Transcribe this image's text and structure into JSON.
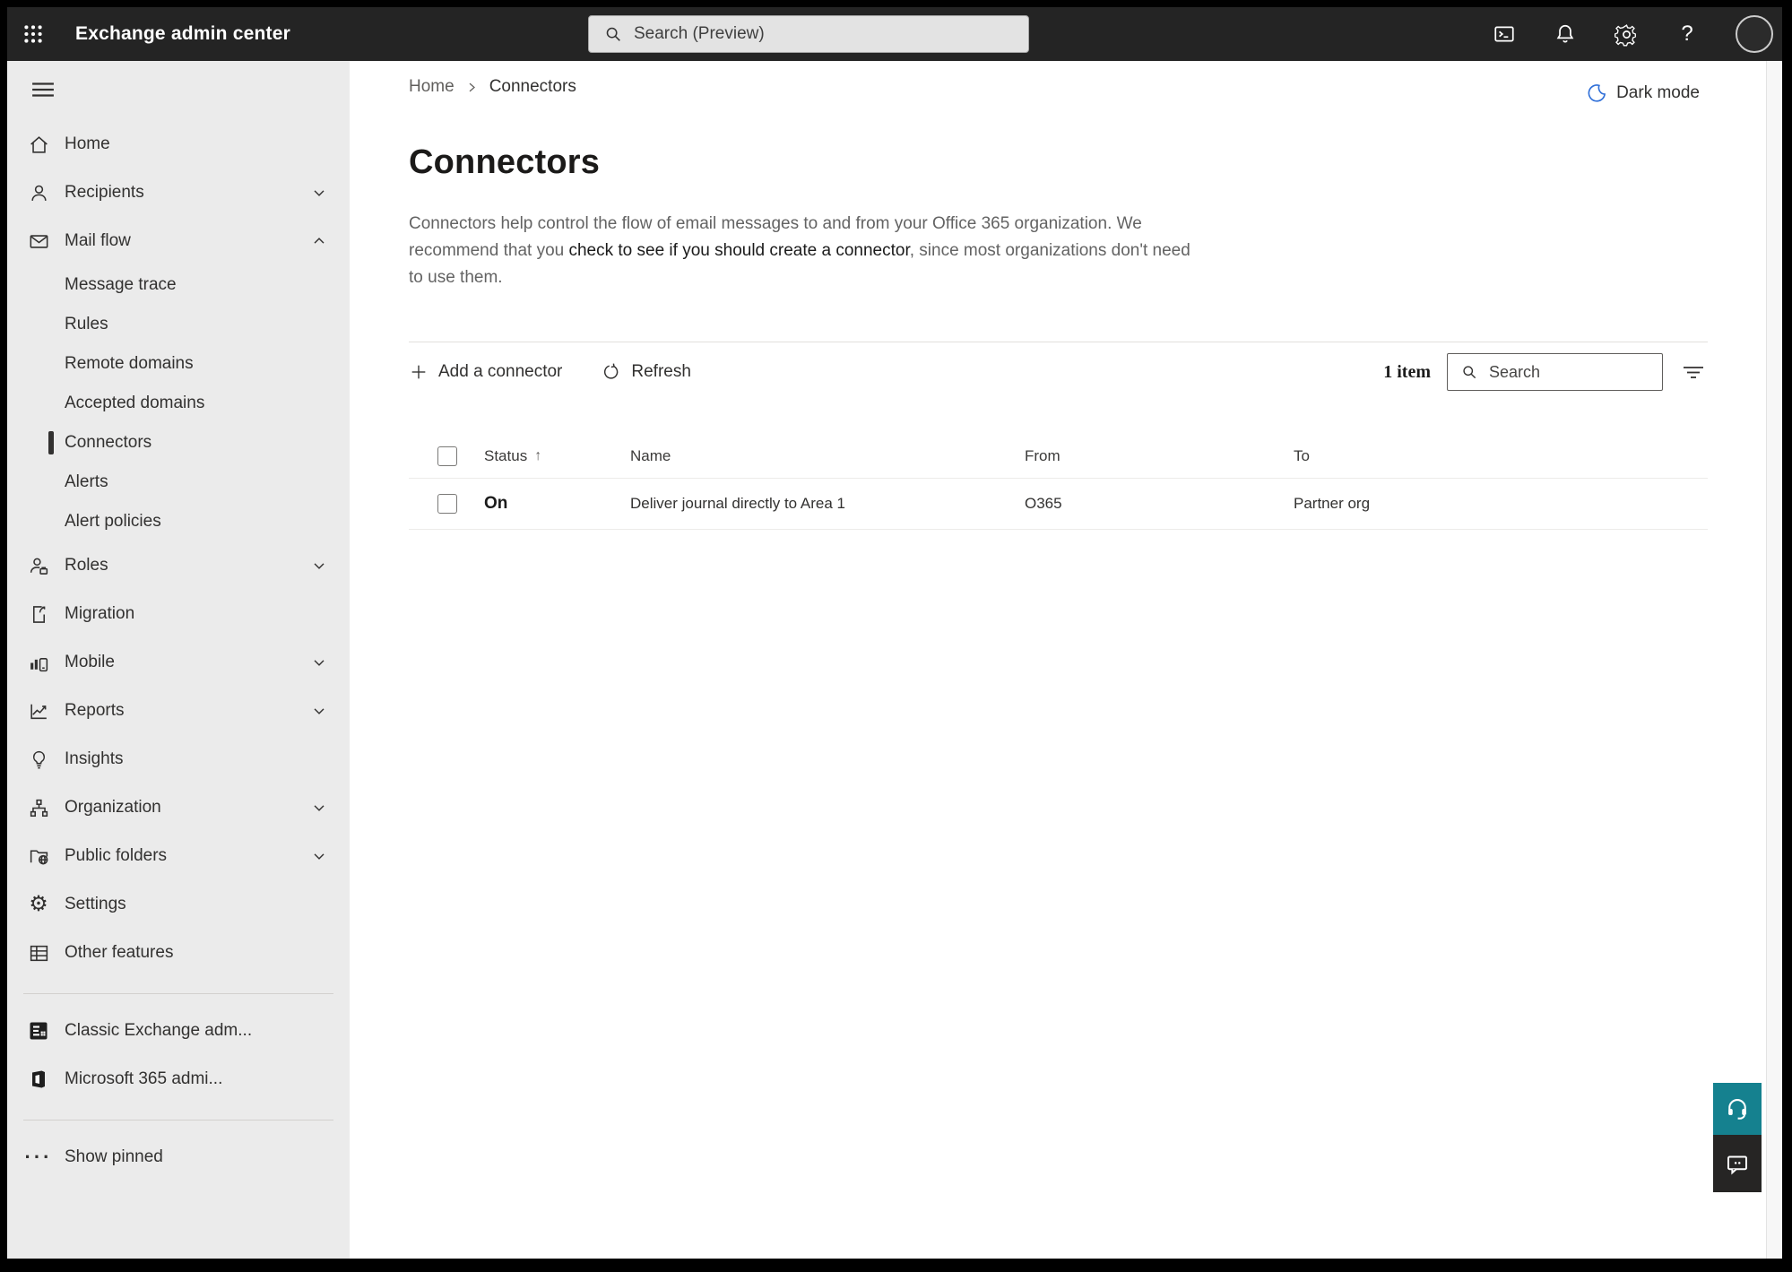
{
  "topbar": {
    "app_title": "Exchange admin center",
    "search_placeholder": "Search (Preview)",
    "icons": [
      "app-launcher-icon",
      "terminal-icon",
      "bell-icon",
      "gear-icon",
      "help-icon",
      "avatar"
    ],
    "help_glyph": "?"
  },
  "breadcrumb": {
    "root": "Home",
    "current": "Connectors"
  },
  "dark_mode": {
    "label": "Dark mode",
    "icon": "moon-icon"
  },
  "sidebar": {
    "items": [
      {
        "label": "Home",
        "icon": "home-icon",
        "type": "top"
      },
      {
        "label": "Recipients",
        "icon": "person-icon",
        "type": "top",
        "chevron": "down"
      },
      {
        "label": "Mail flow",
        "icon": "mail-icon",
        "type": "top",
        "chevron": "up",
        "expanded": true
      },
      {
        "label": "Message trace",
        "type": "sub"
      },
      {
        "label": "Rules",
        "type": "sub"
      },
      {
        "label": "Remote domains",
        "type": "sub"
      },
      {
        "label": "Accepted domains",
        "type": "sub"
      },
      {
        "label": "Connectors",
        "type": "sub",
        "selected": true
      },
      {
        "label": "Alerts",
        "type": "sub"
      },
      {
        "label": "Alert policies",
        "type": "sub"
      },
      {
        "label": "Roles",
        "icon": "roles-icon",
        "type": "top",
        "chevron": "down"
      },
      {
        "label": "Migration",
        "icon": "migration-icon",
        "type": "top"
      },
      {
        "label": "Mobile",
        "icon": "mobile-icon",
        "type": "top",
        "chevron": "down"
      },
      {
        "label": "Reports",
        "icon": "reports-icon",
        "type": "top",
        "chevron": "down"
      },
      {
        "label": "Insights",
        "icon": "insights-icon",
        "type": "top"
      },
      {
        "label": "Organization",
        "icon": "organization-icon",
        "type": "top",
        "chevron": "down"
      },
      {
        "label": "Public folders",
        "icon": "public-folders-icon",
        "type": "top",
        "chevron": "down"
      },
      {
        "label": "Settings",
        "icon": "settings-icon",
        "type": "top"
      },
      {
        "label": "Other features",
        "icon": "other-features-icon",
        "type": "top"
      }
    ],
    "footer_items": [
      {
        "label": "Classic Exchange adm...",
        "icon": "classic-exchange-icon"
      },
      {
        "label": "Microsoft 365 admi...",
        "icon": "microsoft-365-icon"
      }
    ],
    "show_pinned": {
      "label": "Show pinned",
      "icon": "ellipsis-icon"
    },
    "gear_glyph": "⚙",
    "ellipsis_glyph": "···"
  },
  "main": {
    "title": "Connectors",
    "description": {
      "part1": "Connectors help control the flow of email messages to and from your Office 365 organization. We recommend that you ",
      "link": "check to see if you should create a connector",
      "part2": ", since most organizations don't need to use them."
    },
    "toolbar": {
      "add_label": "Add a connector",
      "refresh_label": "Refresh",
      "item_count": "1 item",
      "search_placeholder": "Search"
    },
    "table": {
      "columns": {
        "status": "Status",
        "name": "Name",
        "from": "From",
        "to": "To"
      },
      "sort_arrow": "↑",
      "rows": [
        {
          "status": "On",
          "name": "Deliver journal directly to Area 1",
          "from": "O365",
          "to": "Partner org"
        }
      ]
    }
  },
  "colors": {
    "topbar_bg": "#242424",
    "sidebar_bg": "#ebebeb",
    "accent_moon_blue": "#2f6fd8",
    "help_teal": "#15818f",
    "feedback_dark": "#262524",
    "divider": "#e1dfdd",
    "text_dark": "#323130",
    "text_gray": "#636363"
  }
}
